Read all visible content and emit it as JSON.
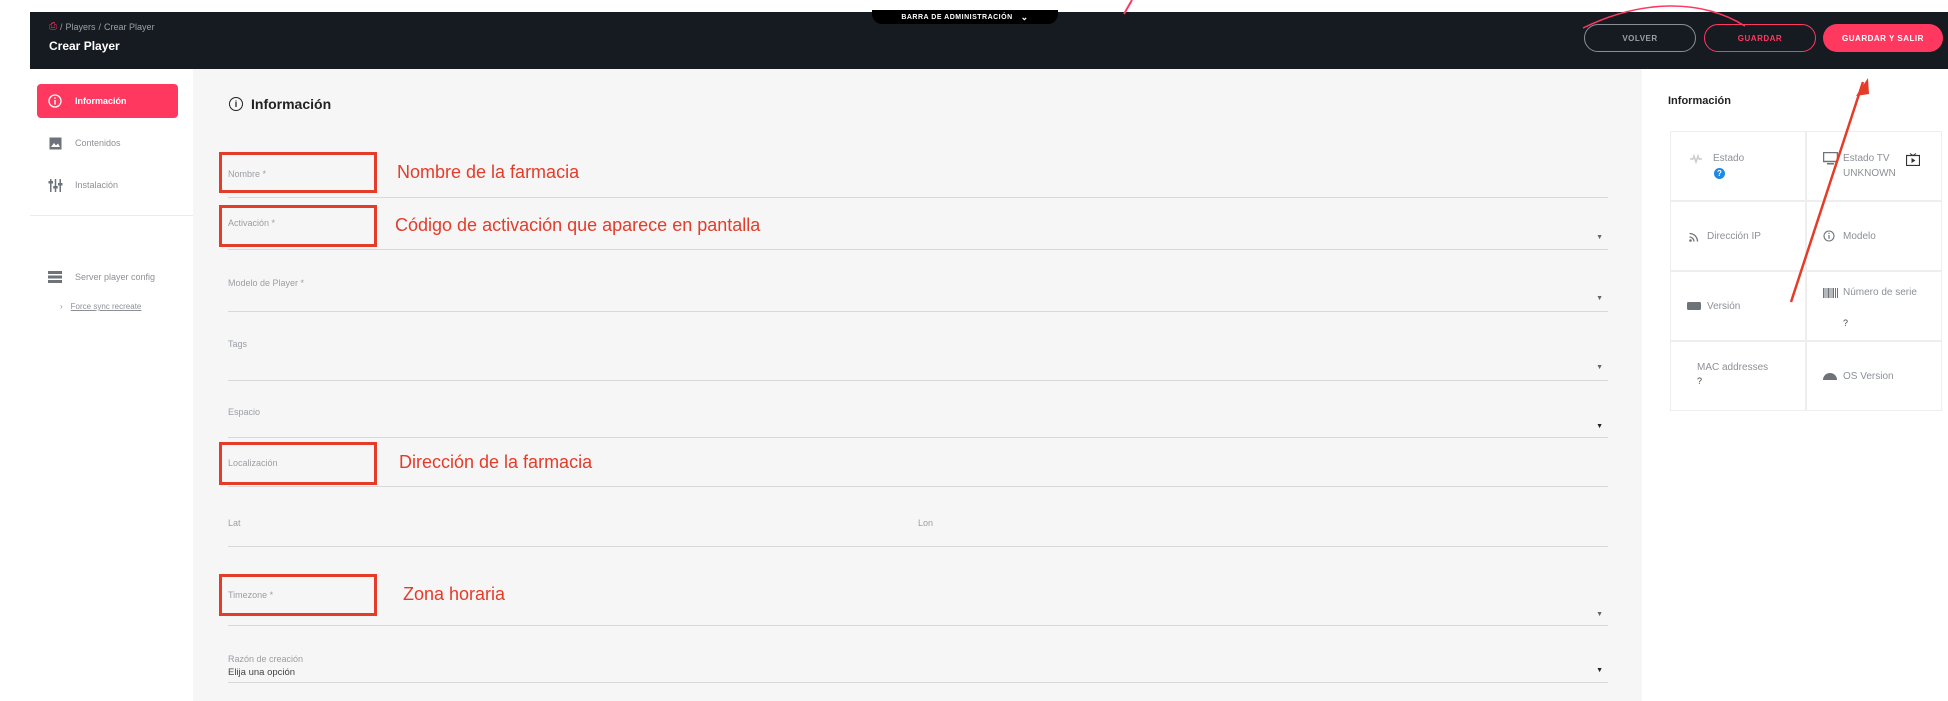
{
  "header": {
    "breadcrumbs": [
      "Players",
      "Crear Player"
    ],
    "title": "Crear Player",
    "admin_bar_label": "BARRA DE ADMINISTRACIÓN",
    "buttons": {
      "volver": "VOLVER",
      "guardar": "GUARDAR",
      "guardar_y_salir": "GUARDAR Y SALIR"
    }
  },
  "sidebar": {
    "items": [
      {
        "label": "Información",
        "icon": "info-icon",
        "active": true
      },
      {
        "label": "Contenidos",
        "icon": "image-icon",
        "active": false
      },
      {
        "label": "Instalación",
        "icon": "sliders-icon",
        "active": false
      }
    ],
    "config_label": "Server player config",
    "sub_link": "Force sync recreate"
  },
  "main": {
    "title": "Información",
    "fields": {
      "nombre": {
        "label": "Nombre *"
      },
      "activacion": {
        "label": "Activación *"
      },
      "modelo": {
        "label": "Modelo de Player *"
      },
      "tags": {
        "label": "Tags"
      },
      "espacio": {
        "label": "Espacio"
      },
      "localizacion": {
        "label": "Localización"
      },
      "lat": {
        "label": "Lat"
      },
      "lon": {
        "label": "Lon"
      },
      "timezone": {
        "label": "Timezone *"
      },
      "razon": {
        "label": "Razón de creación",
        "value": "Elija una opción"
      }
    }
  },
  "annotations": {
    "nombre": "Nombre de la farmacia",
    "activacion": "Código de activación que aparece en pantalla",
    "localizacion": "Dirección de la farmacia",
    "timezone": "Zona horaria"
  },
  "right_panel": {
    "title": "Información",
    "cells": {
      "estado": {
        "label": "Estado"
      },
      "estado_tv": {
        "label": "Estado TV",
        "value": "UNKNOWN"
      },
      "direccion_ip": {
        "label": "Dirección IP"
      },
      "modelo": {
        "label": "Modelo"
      },
      "version": {
        "label": "Versión"
      },
      "numero_serie": {
        "label": "Número de serie",
        "value": "?"
      },
      "mac": {
        "label": "MAC addresses",
        "value": "?"
      },
      "os_version": {
        "label": "OS Version"
      }
    },
    "estado_badge": "?"
  },
  "colors": {
    "accent": "#ff3860",
    "topbar": "#161b22",
    "annotation": "#e53b29",
    "badge_blue": "#1e88e5"
  }
}
